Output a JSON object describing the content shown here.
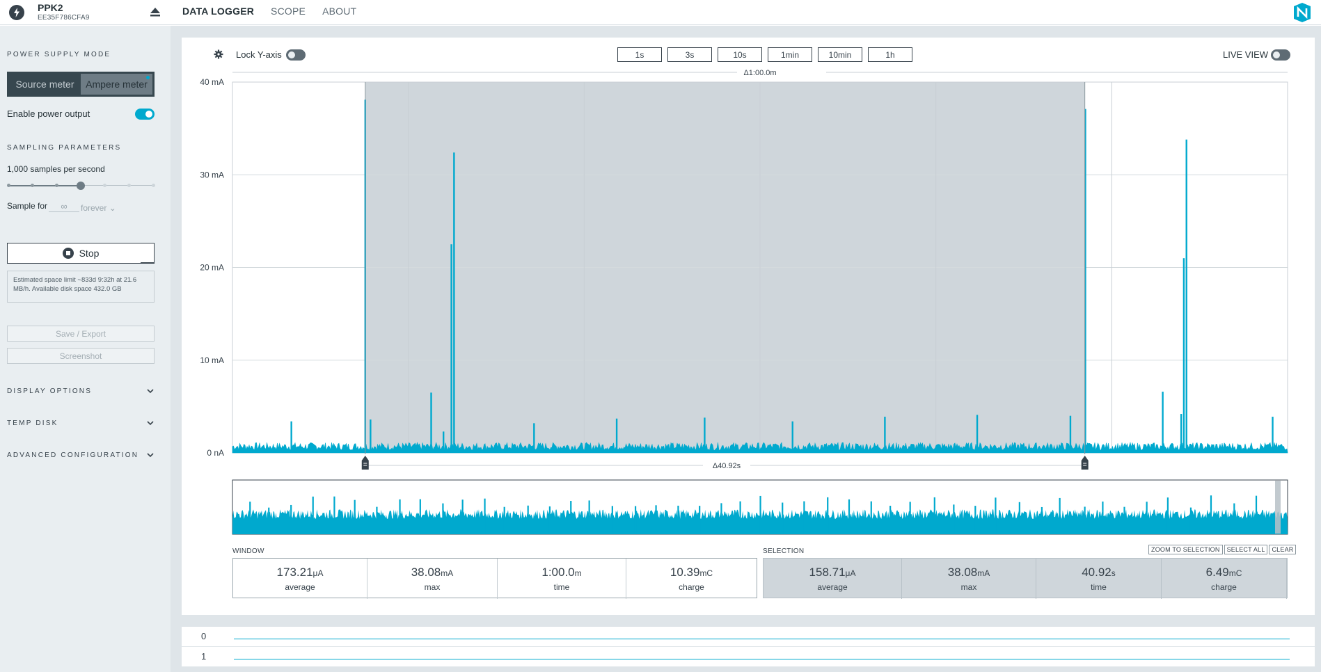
{
  "device": {
    "name": "PPK2",
    "serial": "EE35F786CFA9"
  },
  "nav": {
    "tabs": [
      "DATA LOGGER",
      "SCOPE",
      "ABOUT"
    ],
    "active": "DATA LOGGER"
  },
  "sidebar": {
    "power_supply_mode": {
      "title": "POWER SUPPLY MODE",
      "options": [
        "Source meter",
        "Ampere meter"
      ],
      "selected": "Ampere meter"
    },
    "enable_power_output": {
      "label": "Enable power output",
      "on": true
    },
    "sampling": {
      "title": "SAMPLING PARAMETERS",
      "rate_label": "1,000 samples per second",
      "rate_step": 3,
      "rate_steps": 6,
      "sample_for_label": "Sample for",
      "sample_for_value": "∞",
      "sample_for_unit": "forever"
    },
    "stop_label": "Stop",
    "estimate_text": "Estimated space limit ~833d 9:32h at 21.6 MB/h. Available disk space 432.0 GB",
    "save_export_label": "Save / Export",
    "screenshot_label": "Screenshot",
    "sections": [
      "DISPLAY OPTIONS",
      "TEMP DISK",
      "ADVANCED CONFIGURATION"
    ]
  },
  "toolbar": {
    "lock_y_label": "Lock Y-axis",
    "lock_y_on": false,
    "window_buttons": [
      "1s",
      "3s",
      "10s",
      "1min",
      "10min",
      "1h"
    ],
    "live_view_label": "LIVE VIEW",
    "live_view_on": false
  },
  "chart_data": {
    "type": "line",
    "title": "",
    "xlabel": "",
    "ylabel": "",
    "y_unit": "mA",
    "ylim": [
      0,
      40
    ],
    "y_ticks": [
      "0 nA",
      "10 mA",
      "20 mA",
      "30 mA",
      "40 mA"
    ],
    "x_window_seconds": 60,
    "window_delta_label": "Δ1:00.0m",
    "selection_delta_label": "Δ40.92s",
    "selection_start_s": 7.55,
    "selection_end_s": 48.47,
    "baseline_mA": 0.7,
    "series": [
      {
        "color": "#00a9ce",
        "peaks": [
          {
            "t": 3.35,
            "mA": 3.4
          },
          {
            "t": 7.55,
            "mA": 38.1
          },
          {
            "t": 7.85,
            "mA": 3.6
          },
          {
            "t": 11.3,
            "mA": 6.5
          },
          {
            "t": 12.0,
            "mA": 2.3
          },
          {
            "t": 12.45,
            "mA": 22.5
          },
          {
            "t": 12.6,
            "mA": 32.4
          },
          {
            "t": 17.15,
            "mA": 3.2
          },
          {
            "t": 21.85,
            "mA": 3.7
          },
          {
            "t": 26.85,
            "mA": 3.8
          },
          {
            "t": 31.85,
            "mA": 3.4
          },
          {
            "t": 37.1,
            "mA": 3.9
          },
          {
            "t": 42.35,
            "mA": 4.1
          },
          {
            "t": 47.65,
            "mA": 4.0
          },
          {
            "t": 48.5,
            "mA": 37.1
          },
          {
            "t": 52.9,
            "mA": 6.6
          },
          {
            "t": 53.95,
            "mA": 4.2
          },
          {
            "t": 54.1,
            "mA": 21.0
          },
          {
            "t": 54.25,
            "mA": 33.8
          },
          {
            "t": 59.15,
            "mA": 3.9
          }
        ]
      }
    ]
  },
  "minimap": {
    "spike_count": 48
  },
  "stats": {
    "window_title": "WINDOW",
    "window": [
      {
        "value": "173.21",
        "unit": "μA",
        "label": "average"
      },
      {
        "value": "38.08",
        "unit": "mA",
        "label": "max"
      },
      {
        "value": "1:00.0",
        "unit": "m",
        "label": "time"
      },
      {
        "value": "10.39",
        "unit": "mC",
        "label": "charge"
      }
    ],
    "selection_title": "SELECTION",
    "selection_buttons": [
      "ZOOM TO SELECTION",
      "SELECT ALL",
      "CLEAR"
    ],
    "selection": [
      {
        "value": "158.71",
        "unit": "μA",
        "label": "average"
      },
      {
        "value": "38.08",
        "unit": "mA",
        "label": "max"
      },
      {
        "value": "40.92",
        "unit": "s",
        "label": "time"
      },
      {
        "value": "6.49",
        "unit": "mC",
        "label": "charge"
      }
    ]
  },
  "digital_channels": [
    "0",
    "1"
  ],
  "colors": {
    "accent": "#00a9ce",
    "dark": "#37424b",
    "selection": "#cfd6db"
  }
}
